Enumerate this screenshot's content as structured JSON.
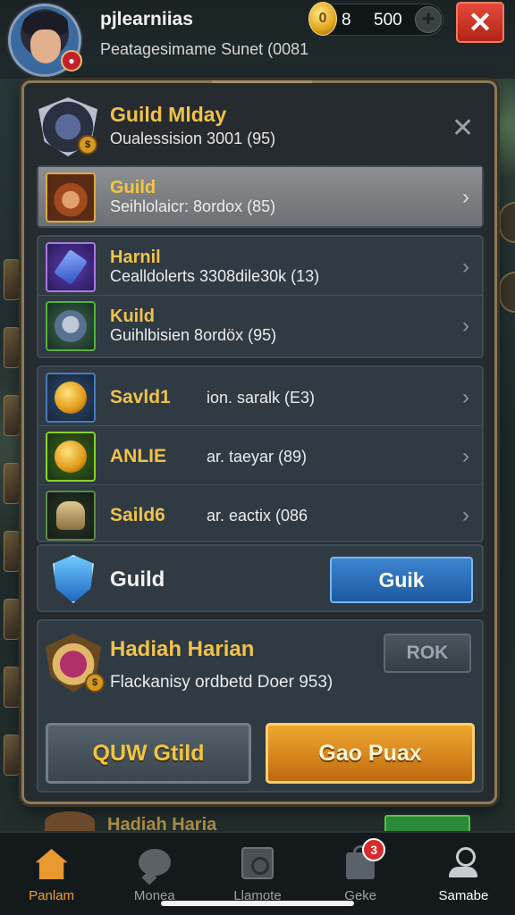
{
  "header": {
    "player_name": "pjlearniias",
    "player_subtitle": "Peatagesimame Sunet (0081",
    "gold_value_a": "8",
    "gold_value_b": "500",
    "coin_symbol": "0"
  },
  "panel": {
    "title": "Guild Mlday",
    "subtitle": "Oualessision 3001 (95)",
    "close_symbol": "✕"
  },
  "quests": [
    {
      "name": "Guild",
      "desc": "Seihlolaicr: 8ordox (85)",
      "icon": "hero-portrait-icon",
      "selected": true
    },
    {
      "name": "Harnil",
      "desc": "Cealldolerts 3308dile30k (13)",
      "icon": "crystal-sword-icon",
      "selected": false
    },
    {
      "name": "Kuild",
      "desc": "Guihlbisien 8ordöx (95)",
      "icon": "knight-helmet-icon",
      "selected": false
    },
    {
      "name": "Savld1",
      "desc": "ion. saralk (E3)",
      "icon": "gold-coin-icon",
      "selected": false
    },
    {
      "name": "ANLIE",
      "desc": "ar. taeyar (89)",
      "icon": "gold-coin-icon",
      "selected": false
    },
    {
      "name": "Saild6",
      "desc": "ar. eactix (086",
      "icon": "gold-helm-icon",
      "selected": false
    }
  ],
  "guild": {
    "label": "Guild",
    "button_label": "Guik"
  },
  "daily": {
    "title": "Hadiah Harian",
    "desc": "Flackanisy ordbetd Doer 953)",
    "claim_label": "ROK",
    "left_button": "QUW Gtild",
    "right_button": "Gao Puax"
  },
  "peek": {
    "title": "Hadiah Haria"
  },
  "bottom_nav": [
    {
      "label": "Panlam",
      "icon": "home-icon",
      "active": true
    },
    {
      "label": "Monea",
      "icon": "chat-icon",
      "active": false
    },
    {
      "label": "Llamote",
      "icon": "vault-icon",
      "active": false
    },
    {
      "label": "Geke",
      "icon": "shop-icon",
      "active": false,
      "badge": "3"
    },
    {
      "label": "Samabe",
      "icon": "profile-icon",
      "active": false
    }
  ],
  "colors": {
    "accent_gold": "#f0c24a",
    "primary_blue": "#2e70b8",
    "orange_button": "#e0902a",
    "close_red": "#c83020"
  }
}
